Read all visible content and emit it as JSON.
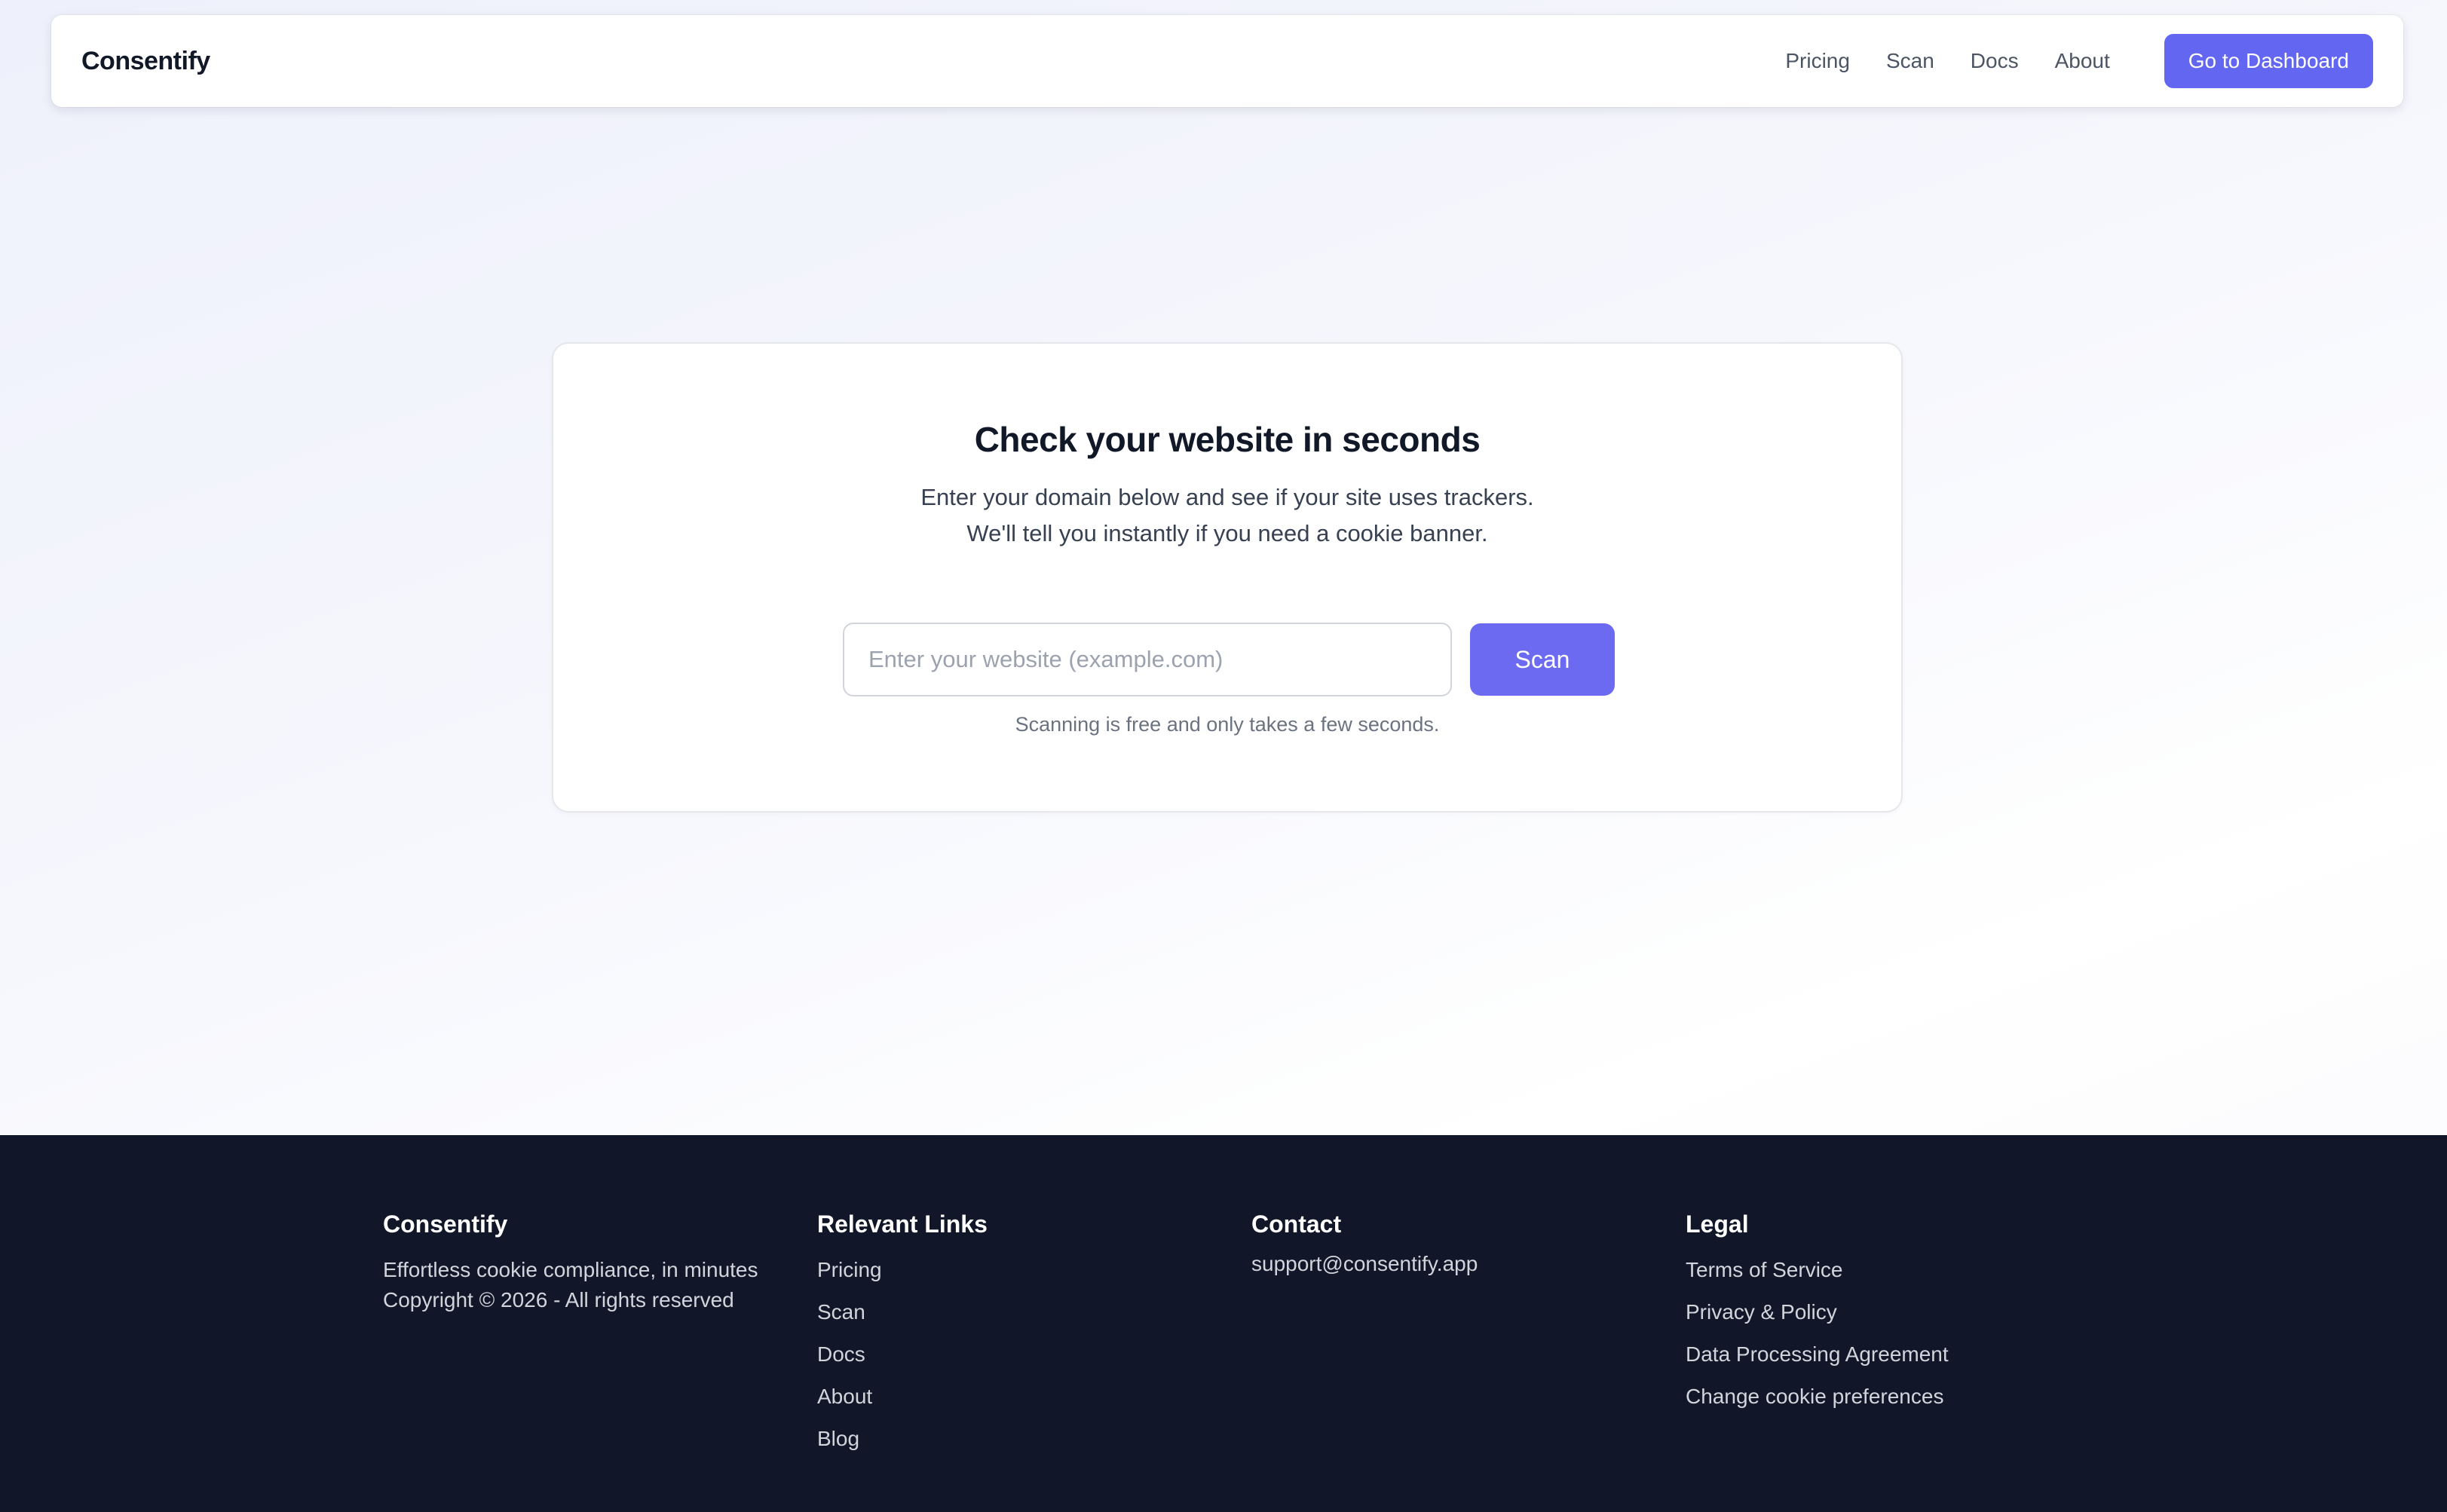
{
  "nav": {
    "brand": "Consentify",
    "links": [
      "Pricing",
      "Scan",
      "Docs",
      "About"
    ],
    "cta": "Go to Dashboard"
  },
  "hero": {
    "title": "Check your website in seconds",
    "subtitle_line1": "Enter your domain below and see if your site uses trackers.",
    "subtitle_line2": "We'll tell you instantly if you need a cookie banner.",
    "input_placeholder": "Enter your website (example.com)",
    "input_value": "",
    "scan_button": "Scan",
    "note": "Scanning is free and only takes a few seconds."
  },
  "footer": {
    "brand": {
      "title": "Consentify",
      "tagline": "Effortless cookie compliance, in minutes",
      "copyright": "Copyright © 2026 - All rights reserved"
    },
    "links": {
      "title": "Relevant Links",
      "items": [
        "Pricing",
        "Scan",
        "Docs",
        "About",
        "Blog"
      ]
    },
    "contact": {
      "title": "Contact",
      "email": "support@consentify.app"
    },
    "legal": {
      "title": "Legal",
      "items": [
        "Terms of Service",
        "Privacy & Policy",
        "Data Processing Agreement",
        "Change cookie preferences"
      ]
    }
  },
  "colors": {
    "accent": "#6366f1",
    "footer_bg": "#111729"
  }
}
